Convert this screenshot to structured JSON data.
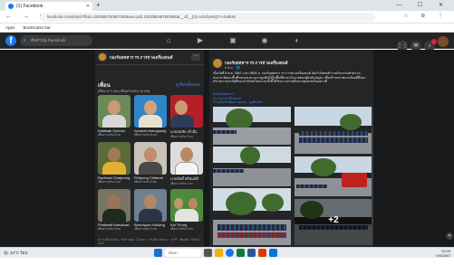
{
  "browser": {
    "tab_title": "(1) Facebook",
    "new_tab": "+",
    "window_controls": "— ☐ ✕",
    "url": "facebook.com/photo/?fbid=1029385750927358&set=pcb.1029386497593950&__cft__[0]=AZUhx0sQ7V-4v9b3K",
    "nav": "← → ⟳ ⌂",
    "addr_icons": "☆ ⊕ ⋮",
    "bookmarks": [
      "Apps",
      "Bookmarks bar"
    ]
  },
  "fb": {
    "logo": "f",
    "search_placeholder": "ค้นหาบน Facebook",
    "nav_icons": [
      "home-icon",
      "watch-icon",
      "marketplace-icon",
      "groups-icon",
      "gaming-icon"
    ],
    "right_icons": [
      "menu-icon",
      "messenger-icon",
      "bell-icon",
      "profile-icon"
    ]
  },
  "page": {
    "name": "กองร้อยทหาร รร.การช่างเครื่องยนต์",
    "friends_title": "เพื่อน",
    "friends_link": "ดูเพื่อนทั้งหมด",
    "friends_count": "เพื่อน 671 คน (เพื่อนร่วมกัน 44 คน)",
    "friends": [
      {
        "name": "Kiattisak Sorinsri",
        "sub": "เพื่อนร่วมกัน 5 คน"
      },
      {
        "name": "Suvarat Nuengsang",
        "sub": "เพื่อนร่วมกัน 8 คน"
      },
      {
        "name": "นายสมชัย เจ้ามือ",
        "sub": "เพื่อนร่วมกัน 3 คน"
      },
      {
        "name": "Rachwat Chatprang",
        "sub": "เพื่อนร่วมกัน 2 คน"
      },
      {
        "name": "Phitpong Chitaree",
        "sub": "เพื่อนร่วมกัน 6 คน"
      },
      {
        "name": "นายสิทธิ์ ศรีสมบัติ",
        "sub": "เพื่อนร่วมกัน 1 คน"
      },
      {
        "name": "Phakawit Kaewkaw",
        "sub": "เพื่อนร่วมกัน 4 คน"
      },
      {
        "name": "Bannapon Koklang",
        "sub": "เพื่อนร่วมกัน 2 คน"
      },
      {
        "name": "Kai Thong",
        "sub": "เพื่อนร่วมกัน 3 คน"
      }
    ],
    "footer": "ความเป็นส่วนตัว · ข้อกำหนด · โฆษณา · ตัวเลือกโฆษณา · คุกกี้ · เพิ่มเติม · Meta © 2024"
  },
  "post": {
    "author": "กองร้อยทหาร รร.การช่างเครื่องยนต์",
    "date": "8 พ.ค. · 🌐",
    "text": "เมื่อวันที่ 8 พ.ค. 2567 เวลา 0800 น. กองร้อยทหาร รร.การช่างเครื่องยนต์ จัดกำลังพลเข้าร่วมกิจกรรมทำความสะอาด พัฒนาพื้นที่รอบหน่วย และปลูกต้นไม้ในพื้นที่ตามนโยบายของผู้บังคับบัญชา เพื่อสร้างสภาพแวดล้อมที่ดีและสร้างความสามัคคีของกำลังพลในหน่วย ทั้งนี้ได้รับความร่วมมือจากทุกฝ่ายเป็นอย่างดี",
    "tags": [
      "#กองร้อยทหาร",
      "#การช่างเครื่องยนต์",
      "#ร่วมมือกันพัฒนาชุมชน · ดูเพิ่มเติม"
    ],
    "more_photos": "+2"
  },
  "taskbar": {
    "weather": "🌤 33°C ร้อน",
    "search": "ค้นหา",
    "clock": "13:49",
    "date": "9/5/2567"
  }
}
